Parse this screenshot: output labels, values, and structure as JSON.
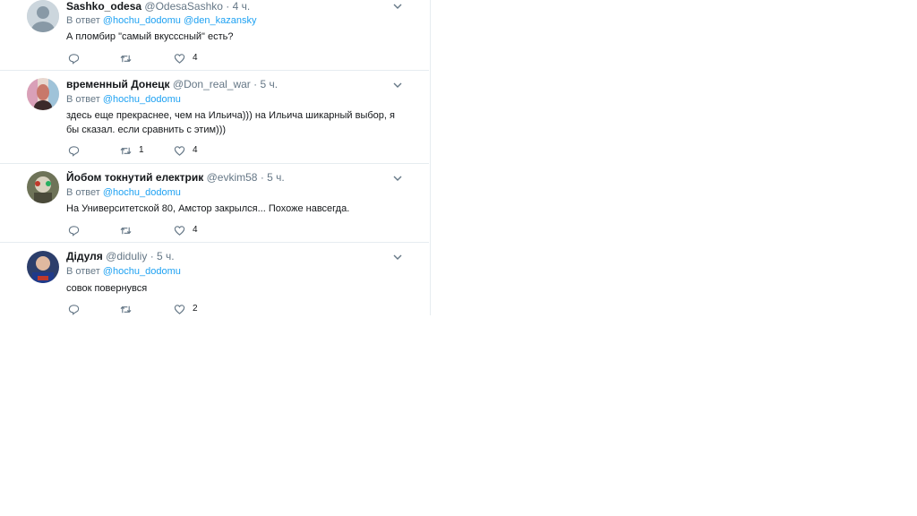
{
  "reply_prefix": "В ответ",
  "tweets": [
    {
      "fullname": "Sashko_odesa",
      "username": "@OdesaSashko",
      "time": "4 ч.",
      "mentions": [
        "@hochu_dodomu",
        "@den_kazansky"
      ],
      "text": "А пломбир \"самый вкусссный\" есть?",
      "retweets": "",
      "likes": "4"
    },
    {
      "fullname": "временный Донецк",
      "username": "@Don_real_war",
      "time": "5 ч.",
      "mentions": [
        "@hochu_dodomu"
      ],
      "text": "здесь еще прекраснее, чем на Ильича))) на Ильича шикарный выбор, я бы сказал. если сравнить с этим)))",
      "retweets": "1",
      "likes": "4"
    },
    {
      "fullname": "Йобом токнутий електрик",
      "username": "@evkim58",
      "time": "5 ч.",
      "mentions": [
        "@hochu_dodomu"
      ],
      "text": "На Университетской 80, Амстор закрылся... Похоже навсегда.",
      "retweets": "",
      "likes": "4"
    },
    {
      "fullname": "Дідуля",
      "username": "@diduliy",
      "time": "5 ч.",
      "mentions": [
        "@hochu_dodomu"
      ],
      "text": "совок повернувся",
      "retweets": "",
      "likes": "2"
    }
  ],
  "colors": {
    "link": "#1da1f2",
    "muted": "#657786",
    "text": "#14171a",
    "divider": "#e6ecf0"
  },
  "icons": {
    "reply": "reply-icon",
    "retweet": "retweet-icon",
    "like": "heart-icon",
    "menu": "chevron-down-icon"
  }
}
